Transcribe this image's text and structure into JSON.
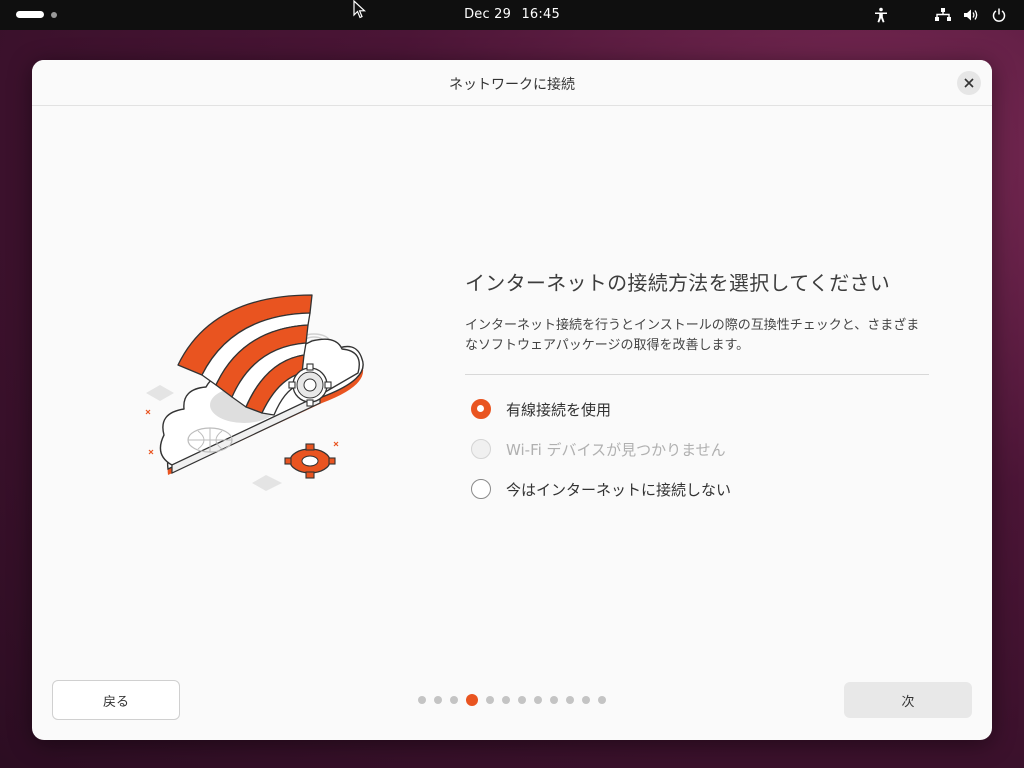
{
  "topbar": {
    "date": "Dec 29",
    "time": "16:45",
    "icons": [
      "accessibility-icon",
      "network-icon",
      "volume-icon",
      "power-icon"
    ]
  },
  "dialog": {
    "title": "ネットワークに接続",
    "heading": "インターネットの接続方法を選択してください",
    "description": "インターネット接続を行うとインストールの際の互換性チェックと、さまざまなソフトウェアパッケージの取得を改善します。",
    "options": [
      {
        "label": "有線接続を使用",
        "selected": true,
        "enabled": true
      },
      {
        "label": "Wi-Fi デバイスが見つかりません",
        "selected": false,
        "enabled": false
      },
      {
        "label": "今はインターネットに接続しない",
        "selected": false,
        "enabled": true
      }
    ],
    "back_label": "戻る",
    "next_label": "次",
    "pager": {
      "total": 12,
      "current": 4
    }
  },
  "colors": {
    "accent": "#e95420",
    "topbar": "#0f0f0f",
    "dialog_bg": "#fafafa"
  }
}
